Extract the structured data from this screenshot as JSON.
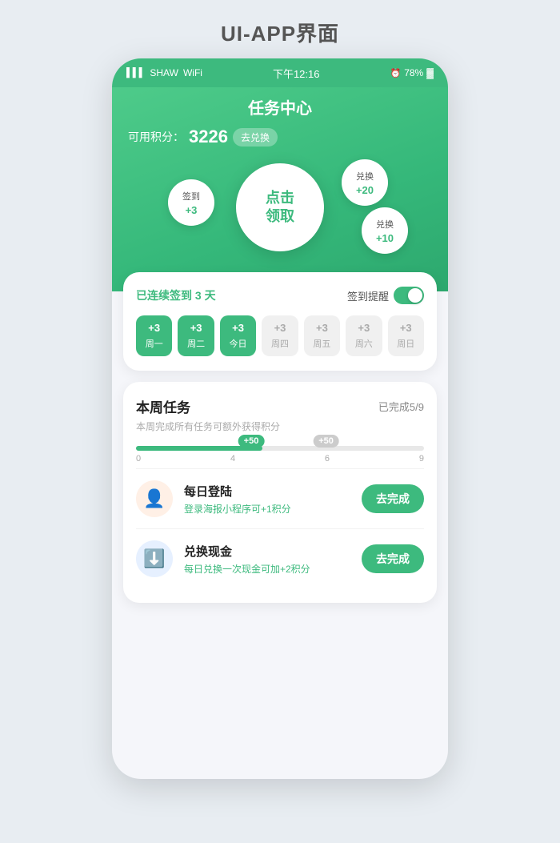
{
  "page": {
    "title": "UI-APP界面",
    "bg_color": "#e8edf2"
  },
  "status_bar": {
    "carrier": "SHAW",
    "time": "下午12:16",
    "battery_percent": "78%",
    "signal_icon": "📶",
    "wifi_icon": "WiFi",
    "alarm_icon": "⏰",
    "battery_icon": "🔋"
  },
  "header": {
    "title": "任务中心",
    "points_label": "可用积分：",
    "points_value": "3226",
    "exchange_btn": "去兑换",
    "main_btn_line1": "点击",
    "main_btn_line2": "领取"
  },
  "circles": {
    "signin": {
      "label": "签到",
      "value": "+3"
    },
    "exchange1": {
      "label": "兑换",
      "value": "+20"
    },
    "exchange2": {
      "label": "兑换",
      "value": "+10"
    }
  },
  "checkin": {
    "streak_text": "已连续签到",
    "streak_days": "3",
    "streak_suffix": "天",
    "reminder_label": "签到提醒",
    "days": [
      {
        "points": "+3",
        "name": "周一",
        "done": true
      },
      {
        "points": "+3",
        "name": "周二",
        "done": true
      },
      {
        "points": "+3",
        "name": "今日",
        "done": true
      },
      {
        "points": "+3",
        "name": "周四",
        "done": false
      },
      {
        "points": "+3",
        "name": "周五",
        "done": false
      },
      {
        "points": "+3",
        "name": "周六",
        "done": false
      },
      {
        "points": "+3",
        "name": "周日",
        "done": false
      }
    ]
  },
  "weekly_tasks": {
    "title": "本周任务",
    "progress_text": "已完成5/9",
    "subtitle": "本周完成所有任务可额外获得积分",
    "progress_fill_percent": 44,
    "progress_bubble_active": "+50",
    "progress_bubble_pending": "+50",
    "progress_labels": [
      "0",
      "4",
      "6",
      "9"
    ],
    "tasks": [
      {
        "name": "每日登陆",
        "desc": "登录海报小程序可+1积分",
        "btn": "去完成",
        "icon_type": "orange",
        "icon_emoji": "👤"
      },
      {
        "name": "兑换现金",
        "desc": "每日兑换一次现金可加+2积分",
        "btn": "去完成",
        "icon_type": "blue",
        "icon_emoji": "⬇️"
      }
    ]
  }
}
